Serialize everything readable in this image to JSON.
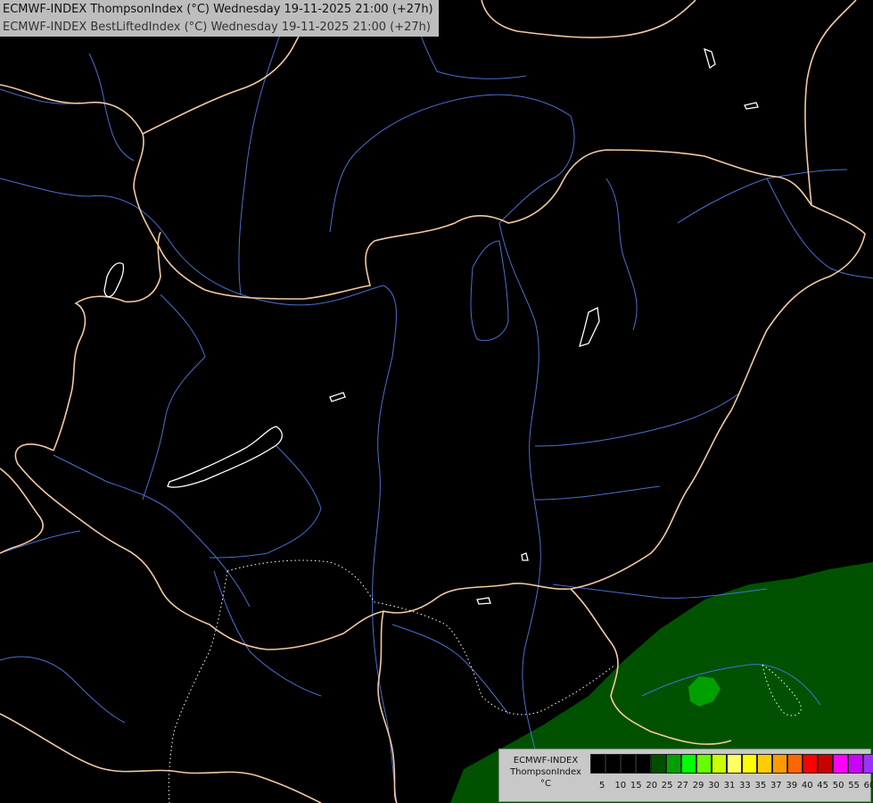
{
  "titles": {
    "line1": "ECMWF-INDEX ThompsonIndex (°C) Wednesday 19-11-2025 21:00 (+27h)",
    "line2": "ECMWF-INDEX BestLiftedIndex (°C) Wednesday 19-11-2025 21:00 (+27h)"
  },
  "legend": {
    "model": "ECMWF-INDEX",
    "parameter": "ThompsonIndex",
    "unit": "°C",
    "ticks": [
      "5",
      "10",
      "15",
      "20",
      "25",
      "27",
      "29",
      "30",
      "31",
      "33",
      "35",
      "37",
      "39",
      "40",
      "45",
      "50",
      "55",
      "60"
    ],
    "colors": [
      "#000000",
      "#000000",
      "#000000",
      "#000000",
      "#004d00",
      "#00a000",
      "#00ff00",
      "#66ff00",
      "#ccff00",
      "#ffff66",
      "#ffff00",
      "#ffcc00",
      "#ff9900",
      "#ff6600",
      "#ff0000",
      "#cc0000",
      "#ff00ff",
      "#cc00ff",
      "#9933ff",
      "#6600ff",
      "#0000ff"
    ]
  },
  "colors": {
    "background": "#000000",
    "border_lines": "#f3c9a0",
    "rivers": "#4a6fd0",
    "lakes": "#ffffff",
    "index_fill_dark": "#004d00",
    "index_fill_mid": "#00a000"
  }
}
